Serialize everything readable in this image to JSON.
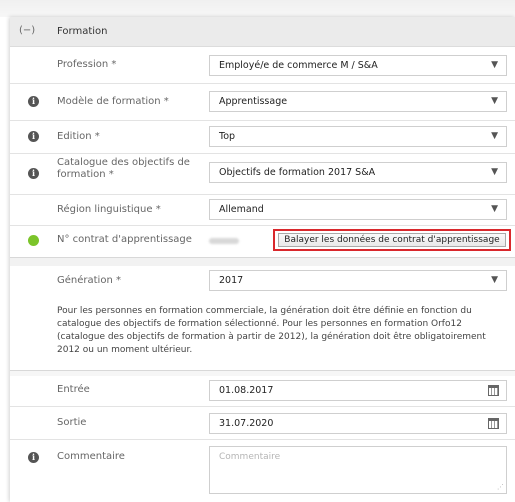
{
  "section": {
    "collapse_icon": "(−)",
    "title": "Formation"
  },
  "fields": {
    "profession": {
      "label": "Profession *",
      "value": "Employé/e de commerce M / S&A"
    },
    "modele": {
      "label": "Modèle de formation *",
      "value": "Apprentissage"
    },
    "edition": {
      "label": "Edition *",
      "value": "Top"
    },
    "catalogue": {
      "label": "Catalogue des objectifs de formation *",
      "value": "Objectifs de formation 2017 S&A"
    },
    "region": {
      "label": "Région linguistique *",
      "value": "Allemand"
    },
    "contrat": {
      "label": "N° contrat d'apprentissage",
      "button": "Balayer les données de contrat d'apprentissage"
    },
    "generation": {
      "label": "Génération *",
      "value": "2017"
    },
    "entree": {
      "label": "Entrée",
      "value": "01.08.2017"
    },
    "sortie": {
      "label": "Sortie",
      "value": "31.07.2020"
    },
    "commentaire": {
      "label": "Commentaire",
      "placeholder": "Commentaire"
    }
  },
  "info_text": "Pour les personnes en formation commerciale, la génération doit être définie en fonction du catalogue des objectifs de formation sélectionné. Pour les personnes en formation Orfo12 (catalogue des objectifs de formation à partir de 2012), la génération doit être obligatoirement 2012 ou un moment ultérieur.",
  "icons": {
    "info": "i",
    "caret": "▼",
    "resize": "⋰"
  },
  "colors": {
    "highlight_border": "#d9282c",
    "status_green": "#7bc42a"
  }
}
